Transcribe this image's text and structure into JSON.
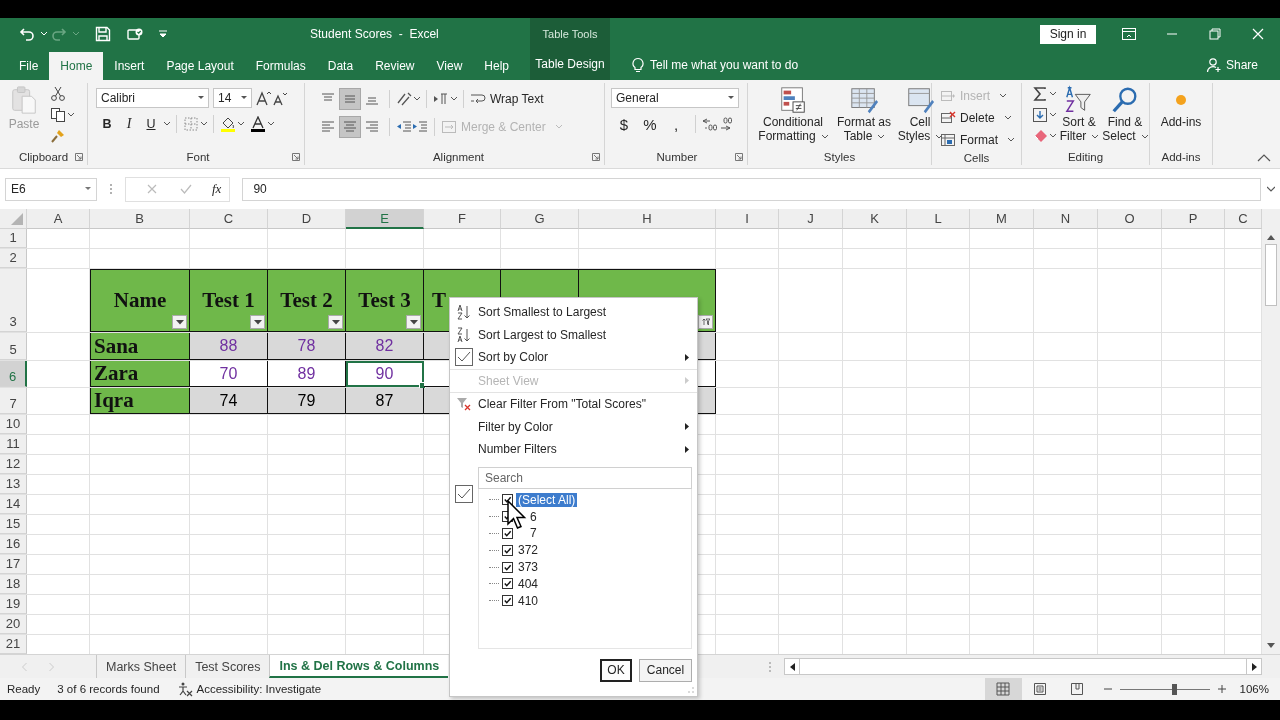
{
  "window": {
    "title": "Student Scores  -  Excel",
    "context_group": "Table Tools",
    "sign_in": "Sign in"
  },
  "tabs": [
    {
      "label": "File",
      "selected": false
    },
    {
      "label": "Home",
      "selected": true
    },
    {
      "label": "Insert",
      "selected": false
    },
    {
      "label": "Page Layout",
      "selected": false
    },
    {
      "label": "Formulas",
      "selected": false
    },
    {
      "label": "Data",
      "selected": false
    },
    {
      "label": "Review",
      "selected": false
    },
    {
      "label": "View",
      "selected": false
    },
    {
      "label": "Help",
      "selected": false
    }
  ],
  "context_tab": {
    "label": "Table Design",
    "selected": false
  },
  "tell_me": {
    "placeholder": "Tell me what you want to do"
  },
  "share": "Share",
  "ribbon": {
    "clipboard": {
      "label": "Clipboard",
      "paste": {
        "label": "Paste",
        "disabled": true
      }
    },
    "font": {
      "label": "Font",
      "name": "Calibri",
      "size": "14",
      "styles": [
        "B",
        "I",
        "U"
      ]
    },
    "alignment": {
      "label": "Alignment",
      "vertical": [
        {
          "kind": "top",
          "selected": false
        },
        {
          "kind": "middle",
          "selected": true
        },
        {
          "kind": "bottom",
          "selected": false
        }
      ],
      "horizontal": [
        {
          "kind": "left",
          "selected": false
        },
        {
          "kind": "center",
          "selected": true
        },
        {
          "kind": "right",
          "selected": false
        }
      ],
      "wrap_text": "Wrap Text",
      "merge": {
        "label": "Merge & Center",
        "disabled": true
      }
    },
    "number": {
      "label": "Number",
      "format": "General",
      "symbols": [
        "$",
        "%",
        ","
      ]
    },
    "styles": {
      "label": "Styles",
      "buttons": [
        {
          "kind": "conditional",
          "label": "Conditional Formatting"
        },
        {
          "kind": "table",
          "label": "Format as Table"
        },
        {
          "kind": "cell",
          "label": "Cell Styles"
        }
      ]
    },
    "cells": {
      "label": "Cells",
      "buttons": [
        {
          "kind": "insert",
          "label": "Insert",
          "disabled": true
        },
        {
          "kind": "delete",
          "label": "Delete",
          "disabled": false
        },
        {
          "kind": "format",
          "label": "Format",
          "disabled": false
        }
      ]
    },
    "editing": {
      "label": "Editing",
      "buttons": [
        {
          "kind": "sort",
          "label": "Sort & Filter"
        },
        {
          "kind": "find",
          "label": "Find & Select"
        }
      ]
    },
    "addins": {
      "label": "Add-ins",
      "button": "Add-ins"
    }
  },
  "formula_bar": {
    "name_box": "E6",
    "function_button": "fx",
    "formula": "90"
  },
  "sheet": {
    "columns": [
      {
        "label": "A",
        "selected": false
      },
      {
        "label": "B",
        "selected": false
      },
      {
        "label": "C",
        "selected": false
      },
      {
        "label": "D",
        "selected": false
      },
      {
        "label": "E",
        "selected": true
      },
      {
        "label": "F",
        "selected": false
      },
      {
        "label": "G",
        "selected": false
      },
      {
        "label": "H",
        "selected": false
      },
      {
        "label": "I",
        "selected": false
      },
      {
        "label": "J",
        "selected": false
      },
      {
        "label": "K",
        "selected": false
      },
      {
        "label": "L",
        "selected": false
      },
      {
        "label": "M",
        "selected": false
      },
      {
        "label": "N",
        "selected": false
      },
      {
        "label": "O",
        "selected": false
      },
      {
        "label": "P",
        "selected": false
      },
      {
        "label": "C",
        "selected": false
      }
    ],
    "rows": [
      {
        "label": "1",
        "selected": false
      },
      {
        "label": "2",
        "selected": false
      },
      {
        "label": "3",
        "selected": false
      },
      {
        "label": "5",
        "selected": false
      },
      {
        "label": "6",
        "selected": true
      },
      {
        "label": "7",
        "selected": false
      },
      {
        "label": "10",
        "selected": false
      },
      {
        "label": "11",
        "selected": false
      },
      {
        "label": "12",
        "selected": false
      },
      {
        "label": "13",
        "selected": false
      },
      {
        "label": "14",
        "selected": false
      },
      {
        "label": "15",
        "selected": false
      },
      {
        "label": "16",
        "selected": false
      },
      {
        "label": "17",
        "selected": false
      },
      {
        "label": "18",
        "selected": false
      },
      {
        "label": "19",
        "selected": false
      },
      {
        "label": "20",
        "selected": false
      },
      {
        "label": "21",
        "selected": false
      }
    ],
    "table": {
      "headers": [
        {
          "label": "Name",
          "kind": "dropdown"
        },
        {
          "label": "Test 1",
          "kind": "dropdown"
        },
        {
          "label": "Test 2",
          "kind": "dropdown"
        },
        {
          "label": "Test 3",
          "kind": "dropdown"
        },
        {
          "label": "T",
          "cut": true
        },
        {
          "kind": "plain"
        },
        {
          "kind": "applied"
        }
      ],
      "rows": [
        {
          "name": "Sana",
          "scores": [
            "88",
            "78",
            "82"
          ],
          "shaded": true,
          "color": "#7030a0"
        },
        {
          "name": "Zara",
          "scores": [
            "70",
            "89",
            "90"
          ],
          "shaded": false,
          "color": "#7030a0"
        },
        {
          "name": "Iqra",
          "scores": [
            "74",
            "79",
            "87"
          ],
          "shaded": true,
          "color": "#000000"
        }
      ]
    }
  },
  "filter_menu": {
    "items": [
      {
        "kind": "sort-asc",
        "label": "Sort Smallest to Largest",
        "separator": false,
        "disabled": false,
        "submenu": false
      },
      {
        "kind": "sort-desc",
        "label": "Sort Largest to Smallest",
        "separator": false,
        "disabled": false,
        "submenu": false
      },
      {
        "kind": "checked",
        "label": "Sort by Color",
        "separator": false,
        "disabled": false,
        "submenu": true
      },
      {
        "kind": "plain",
        "label": "Sheet View",
        "separator": true,
        "disabled": true,
        "submenu": true
      },
      {
        "kind": "clear-filter",
        "label": "Clear Filter From \"Total Scores\"",
        "separator": true,
        "disabled": false,
        "submenu": false
      },
      {
        "kind": "plain",
        "label": "Filter by Color",
        "separator": false,
        "disabled": false,
        "submenu": true
      },
      {
        "kind": "plain",
        "label": "Number Filters",
        "separator": false,
        "disabled": false,
        "submenu": true
      }
    ],
    "search": {
      "placeholder": "Search"
    },
    "values": [
      {
        "label": "(Select All)",
        "checked": true,
        "selected": true
      },
      {
        "label": "6",
        "checked": true,
        "selected": false
      },
      {
        "label": "7",
        "checked": true,
        "selected": false
      },
      {
        "label": "372",
        "checked": true,
        "selected": false
      },
      {
        "label": "373",
        "checked": true,
        "selected": false
      },
      {
        "label": "404",
        "checked": true,
        "selected": false
      },
      {
        "label": "410",
        "checked": true,
        "selected": false
      }
    ],
    "ok": "OK",
    "cancel": "Cancel"
  },
  "sheet_tabs": [
    {
      "label": "Marks Sheet",
      "selected": false
    },
    {
      "label": "Test Scores",
      "selected": false
    },
    {
      "label": "Ins & Del Rows & Columns",
      "selected": true
    }
  ],
  "status_bar": {
    "mode": "Ready",
    "records": "3 of 6 records found",
    "accessibility": "Accessibility: Investigate",
    "views": [
      {
        "kind": "normal",
        "selected": true
      },
      {
        "kind": "page-layout",
        "selected": false
      },
      {
        "kind": "page-break",
        "selected": false
      }
    ],
    "zoom": {
      "level": 0.6,
      "label": "106%"
    }
  }
}
